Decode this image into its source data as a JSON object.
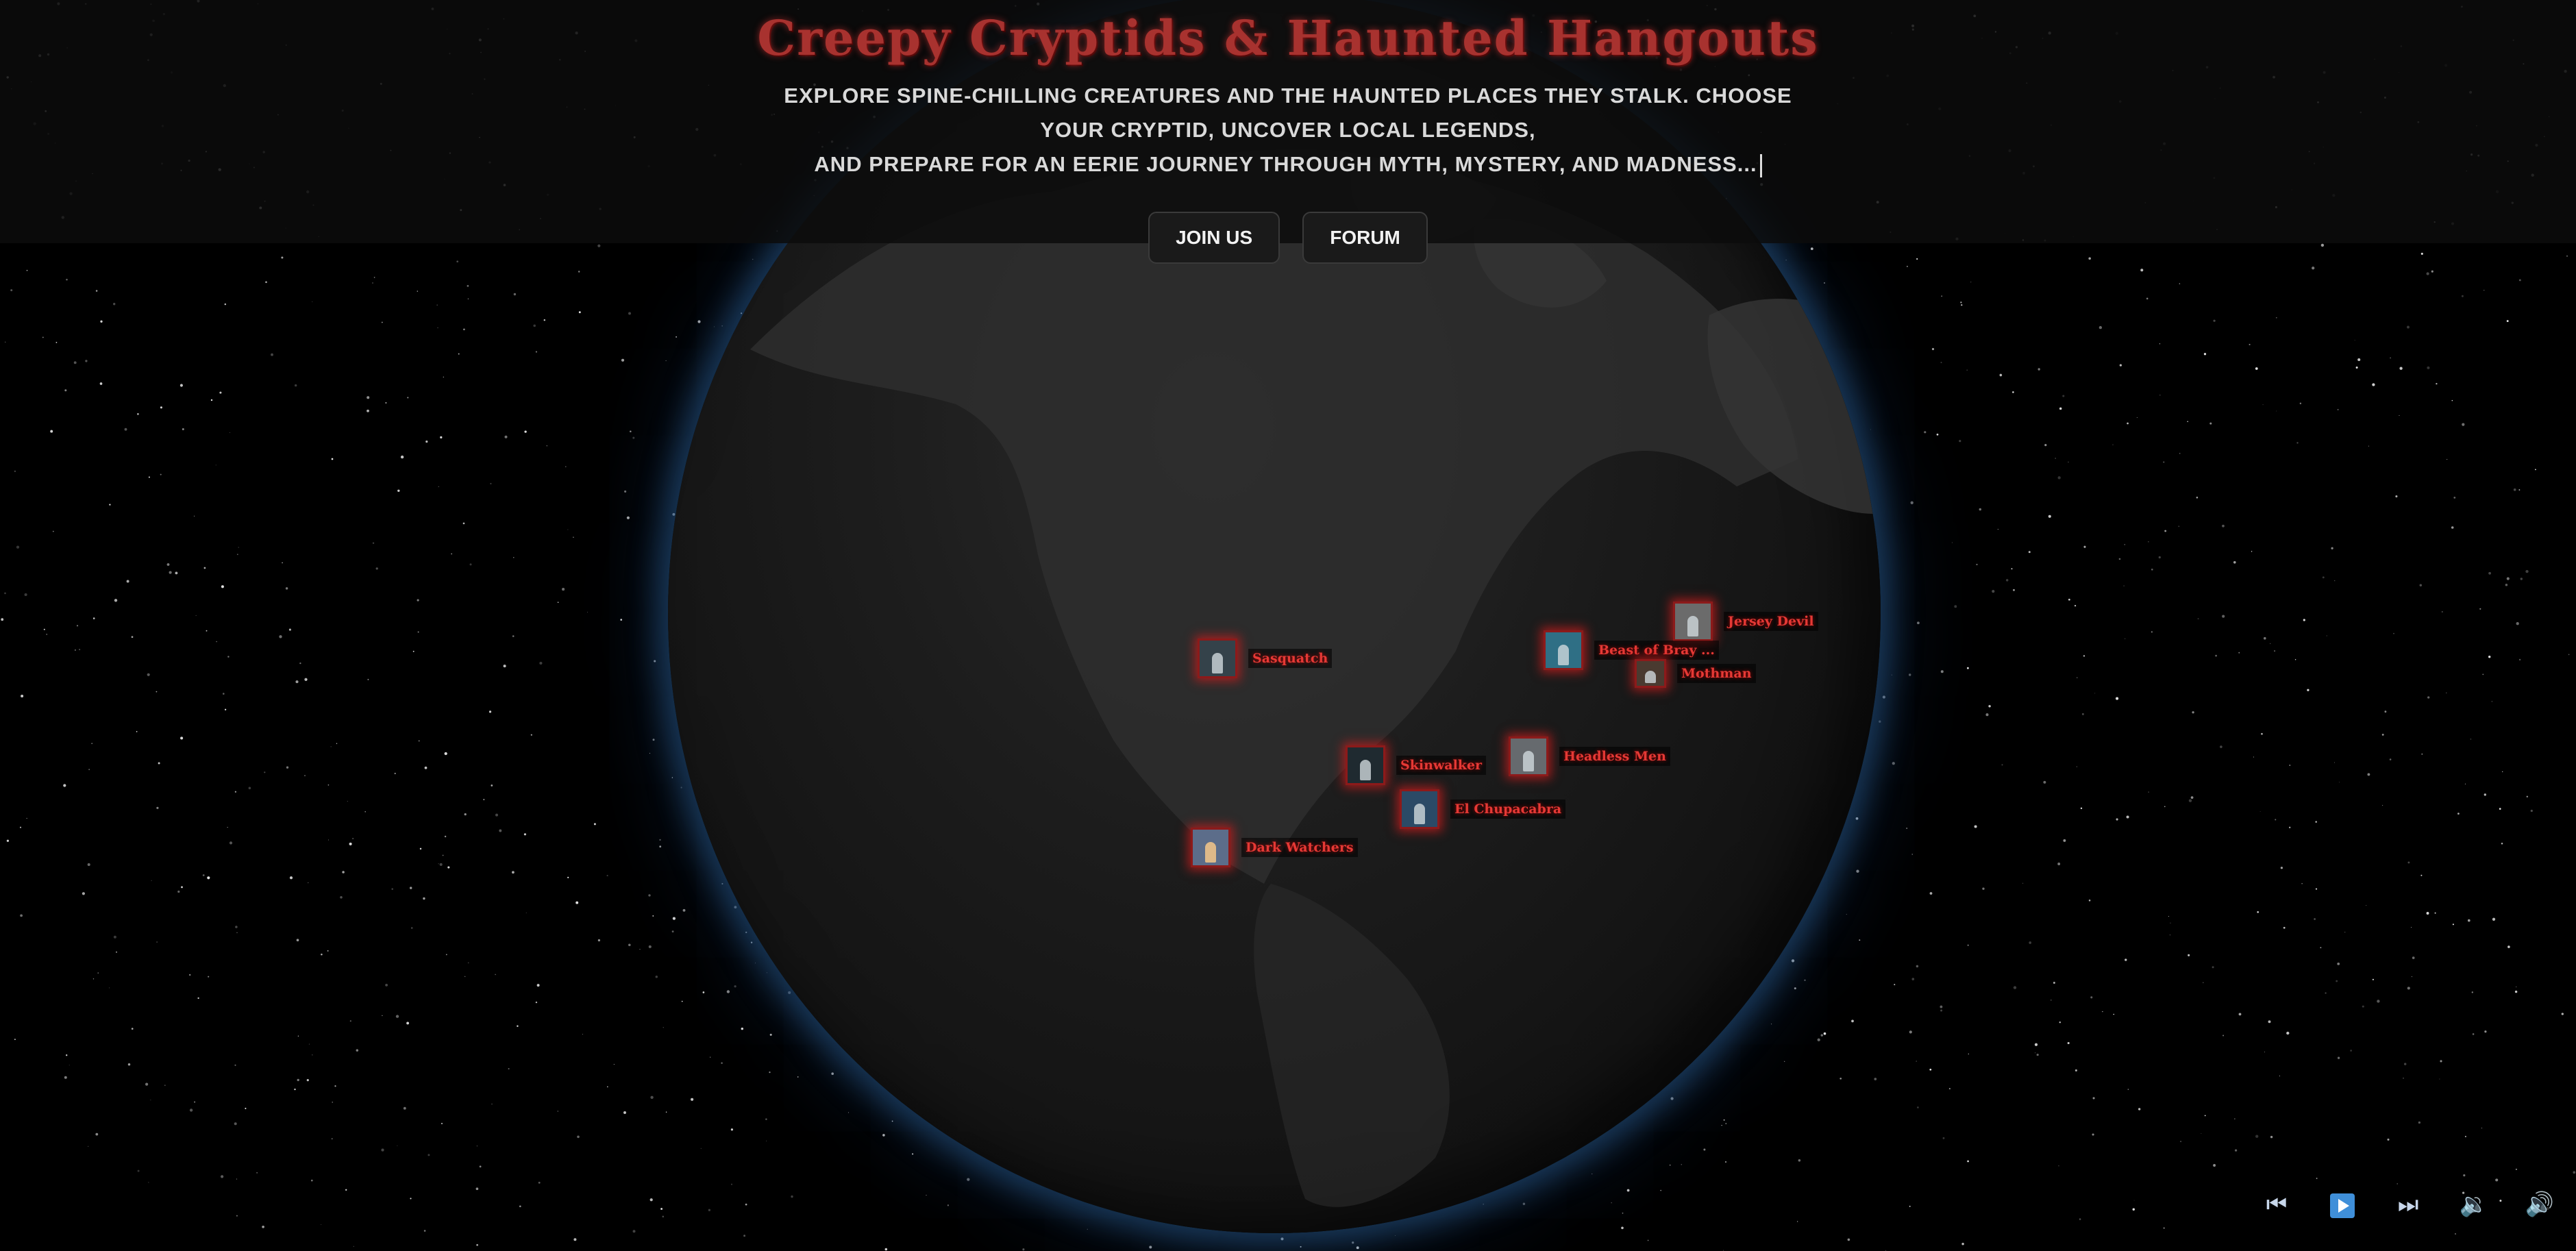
{
  "header": {
    "title": "Creepy Cryptids & Haunted Hangouts",
    "subtitle_line1": "Explore spine-chilling creatures and the haunted places they stalk. Choose your cryptid, uncover local legends,",
    "subtitle_line2": "and prepare for an eerie journey through myth, mystery, and madness..."
  },
  "buttons": {
    "join": "Join Us",
    "forum": "Forum"
  },
  "markers": [
    {
      "label": "Sasquatch"
    },
    {
      "label": "Jersey Devil"
    },
    {
      "label": "Beast of Bray ..."
    },
    {
      "label": "Mothman"
    },
    {
      "label": "Skinwalker"
    },
    {
      "label": "Headless Men"
    },
    {
      "label": "El Chupacabra"
    },
    {
      "label": "Dark Watchers"
    }
  ],
  "player": {
    "prev_icon": "skip-previous-icon",
    "play_icon": "play-icon",
    "next_icon": "skip-next-icon",
    "volume_down_icon": "volume-down-icon",
    "volume_up_icon": "volume-up-icon"
  },
  "colors": {
    "title": "#a8322f",
    "marker_glow": "#e53935",
    "globe_rim": "#2c5a8c",
    "play_button": "#3f8fd9"
  }
}
